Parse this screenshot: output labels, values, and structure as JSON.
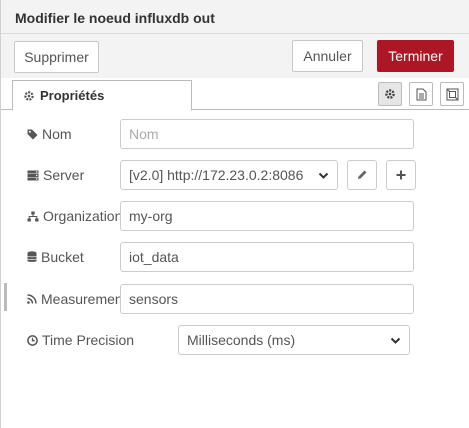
{
  "header": {
    "title": "Modifier le noeud influxdb out"
  },
  "toolbar": {
    "delete_label": "Supprimer",
    "cancel_label": "Annuler",
    "done_label": "Terminer",
    "done_color": "#ad1625"
  },
  "tabs": {
    "properties_label": "Propriétés",
    "icons": [
      "gear-icon",
      "description-icon",
      "appearance-icon"
    ]
  },
  "form": {
    "name": {
      "label": "Nom",
      "placeholder": "Nom",
      "value": ""
    },
    "server": {
      "label": "Server",
      "value": "[v2.0] http://172.23.0.2:8086"
    },
    "organization": {
      "label": "Organization",
      "value": "my-org"
    },
    "bucket": {
      "label": "Bucket",
      "value": "iot_data"
    },
    "measurement": {
      "label": "Measurement",
      "value": "sensors"
    },
    "time_precision": {
      "label": "Time Precision",
      "value": "Milliseconds (ms)"
    }
  }
}
